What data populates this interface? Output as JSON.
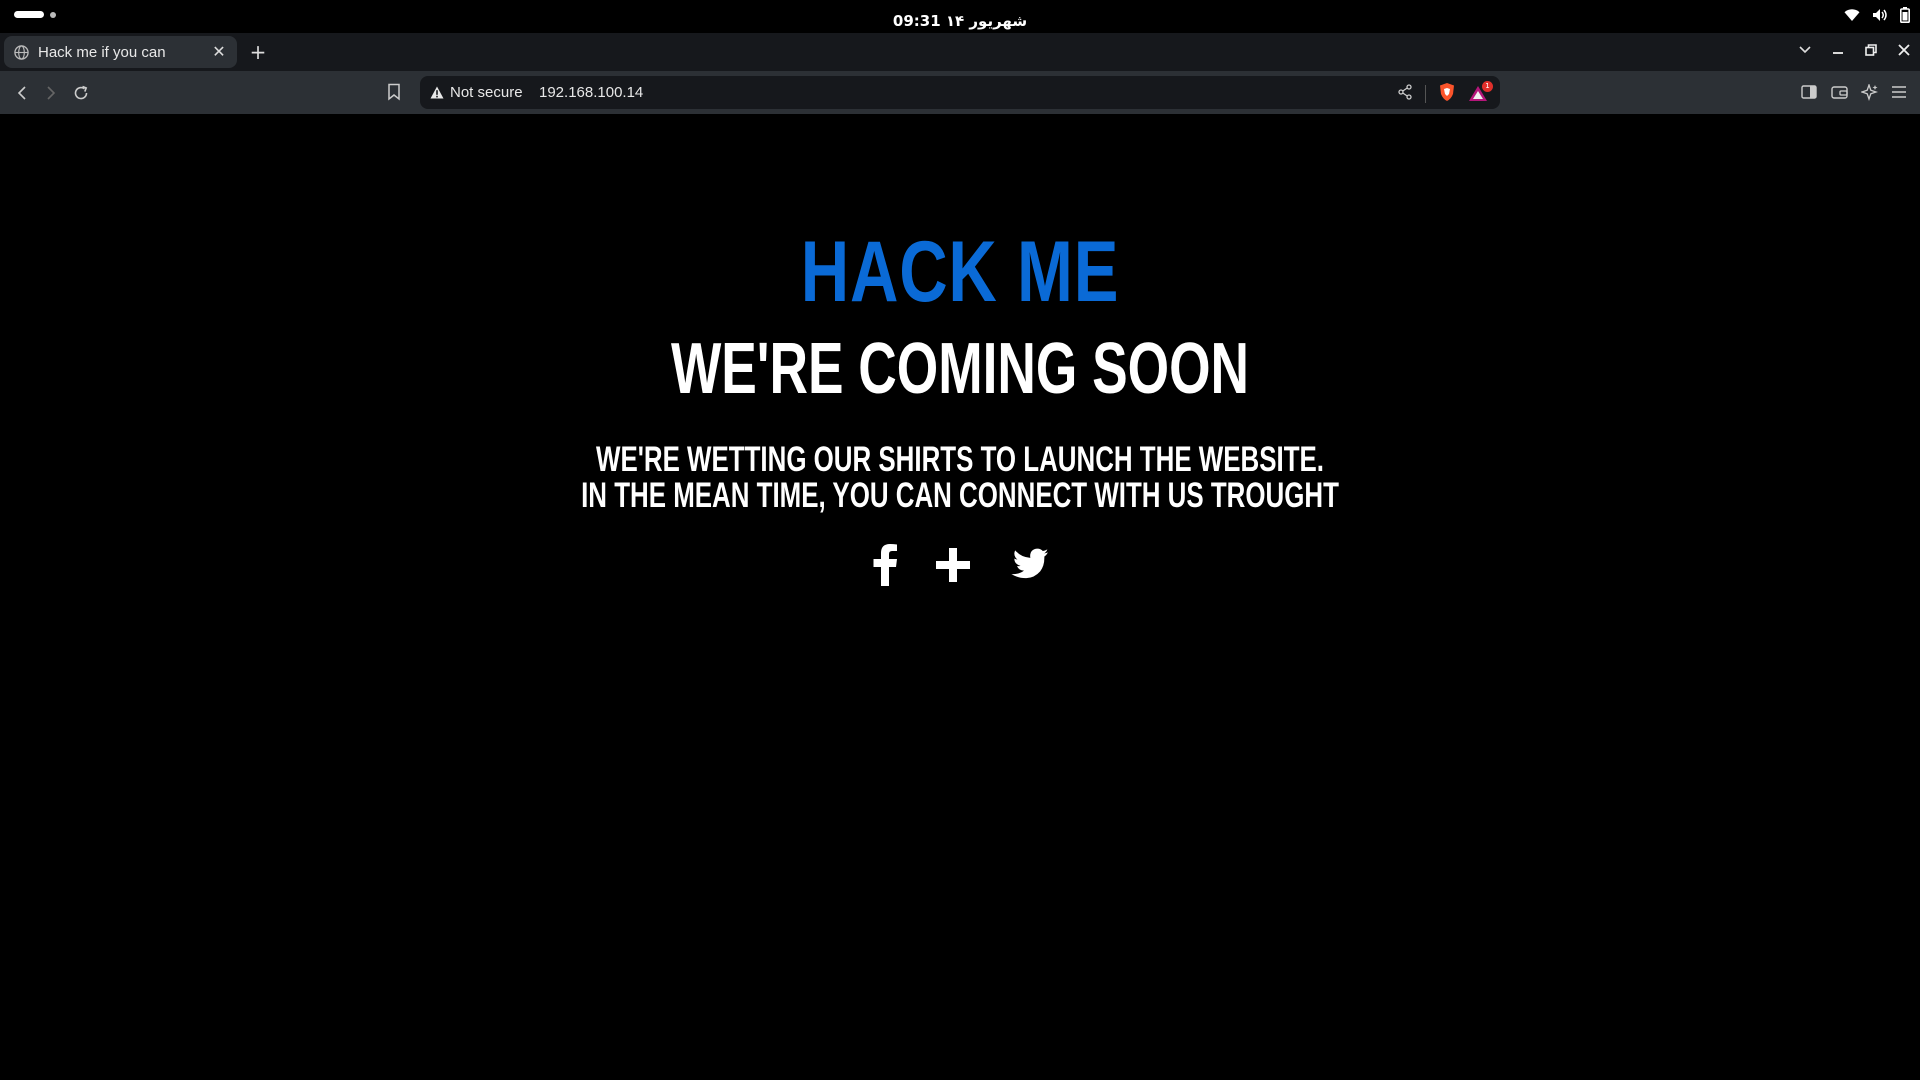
{
  "system_bar": {
    "clock": "09:31 ۱۴ شهریور"
  },
  "browser": {
    "tab": {
      "title": "Hack me if you can",
      "close_glyph": "✕"
    },
    "new_tab_glyph": "+",
    "address_bar": {
      "security_label": "Not secure",
      "url": "192.168.100.14"
    },
    "rewards_badge": "1"
  },
  "page": {
    "title": "HACK ME",
    "subtitle": "WE'RE COMING SOON",
    "message_line1": "WE'RE WETTING OUR SHIRTS TO LAUNCH THE WEBSITE.",
    "message_line2": "IN THE MEAN TIME, YOU CAN CONNECT WITH US TROUGHT",
    "social_icons": [
      "facebook-icon",
      "google-plus-icon",
      "twitter-icon"
    ]
  },
  "colors": {
    "page_background": "#000000",
    "title_accent": "#0a6ad6",
    "text": "#ffffff",
    "tabstrip": "#16181c",
    "toolbar": "#2c3035"
  }
}
